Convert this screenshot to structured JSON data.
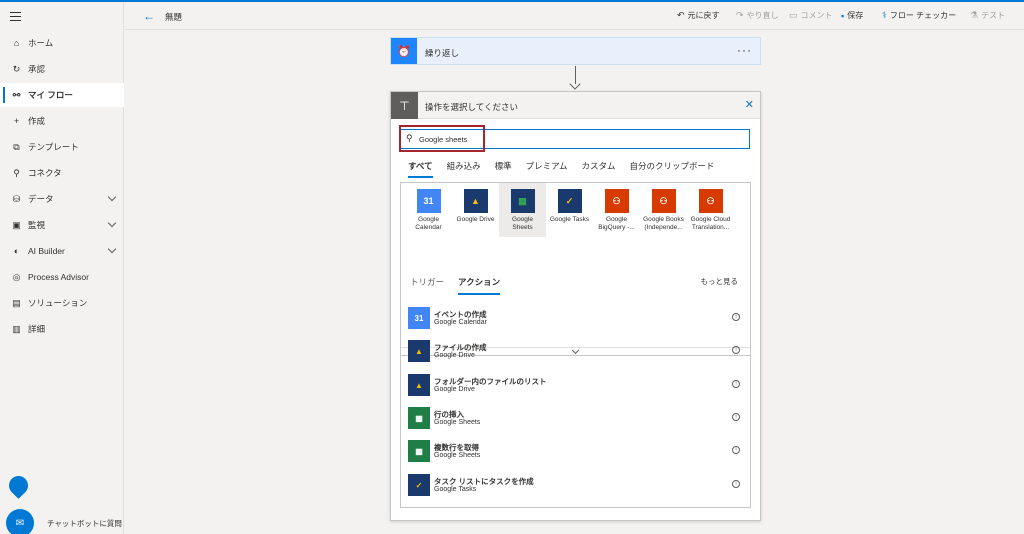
{
  "sidebar": {
    "items": [
      {
        "label": "ホーム",
        "icon": "home-icon"
      },
      {
        "label": "承認",
        "icon": "approvals-icon"
      },
      {
        "label": "マイ フロー",
        "icon": "flow-icon"
      },
      {
        "label": "作成",
        "icon": "plus-icon"
      },
      {
        "label": "テンプレート",
        "icon": "template-icon"
      },
      {
        "label": "コネクタ",
        "icon": "connector-icon"
      },
      {
        "label": "データ",
        "icon": "database-icon"
      },
      {
        "label": "監視",
        "icon": "monitor-icon"
      },
      {
        "label": "AI Builder",
        "icon": "ai-icon"
      },
      {
        "label": "Process Advisor",
        "icon": "process-icon"
      },
      {
        "label": "ソリューション",
        "icon": "solution-icon"
      },
      {
        "label": "詳細",
        "icon": "book-icon"
      }
    ],
    "chatbot_label": "チャットボットに質問"
  },
  "topbar": {
    "title": "無題",
    "undo": "元に戻す",
    "redo": "やり直し",
    "comment": "コメント",
    "save": "保存",
    "checker": "フロー チェッカー",
    "test": "テスト"
  },
  "loop_card": {
    "title": "繰り返し",
    "more": "···"
  },
  "panel": {
    "title": "操作を選択してください",
    "search_value": "Google sheets",
    "tabs": [
      "すべて",
      "組み込み",
      "標準",
      "プレミアム",
      "カスタム",
      "自分のクリップボード"
    ],
    "connectors": [
      {
        "line1": "Google",
        "line2": "Calendar",
        "badge": "31",
        "color": "#4285f4"
      },
      {
        "line1": "Google Drive",
        "line2": "",
        "badge": "▲",
        "color": "#1a3a6e"
      },
      {
        "line1": "Google",
        "line2": "Sheets",
        "badge": "▦",
        "color": "#1a3a6e"
      },
      {
        "line1": "Google Tasks",
        "line2": "",
        "badge": "✓",
        "color": "#1a3a6e"
      },
      {
        "line1": "Google",
        "line2": "BigQuery -...",
        "badge": "⚇",
        "color": "#d83b01"
      },
      {
        "line1": "Google Books",
        "line2": "(Independe...",
        "badge": "⚇",
        "color": "#d83b01"
      },
      {
        "line1": "Google Cloud",
        "line2": "Translation...",
        "badge": "⚇",
        "color": "#d83b01"
      }
    ],
    "sub_tabs": [
      "トリガー",
      "アクション"
    ],
    "see_more": "もっと見る",
    "actions": [
      {
        "title": "イベントの作成",
        "connector": "Google Calendar",
        "badge": "31",
        "color": "#4285f4"
      },
      {
        "title": "ファイルの作成",
        "connector": "Google Drive",
        "badge": "▲",
        "color": "#1a3a6e"
      },
      {
        "title": "フォルダー内のファイルのリスト",
        "connector": "Google Drive",
        "badge": "▲",
        "color": "#1a3a6e"
      },
      {
        "title": "行の挿入",
        "connector": "Google Sheets",
        "badge": "▦",
        "color": "#1e7e45"
      },
      {
        "title": "複数行を取得",
        "connector": "Google Sheets",
        "badge": "▦",
        "color": "#1e7e45"
      },
      {
        "title": "タスク リストにタスクを作成",
        "connector": "Google Tasks",
        "badge": "✓",
        "color": "#1a3a6e"
      }
    ]
  }
}
